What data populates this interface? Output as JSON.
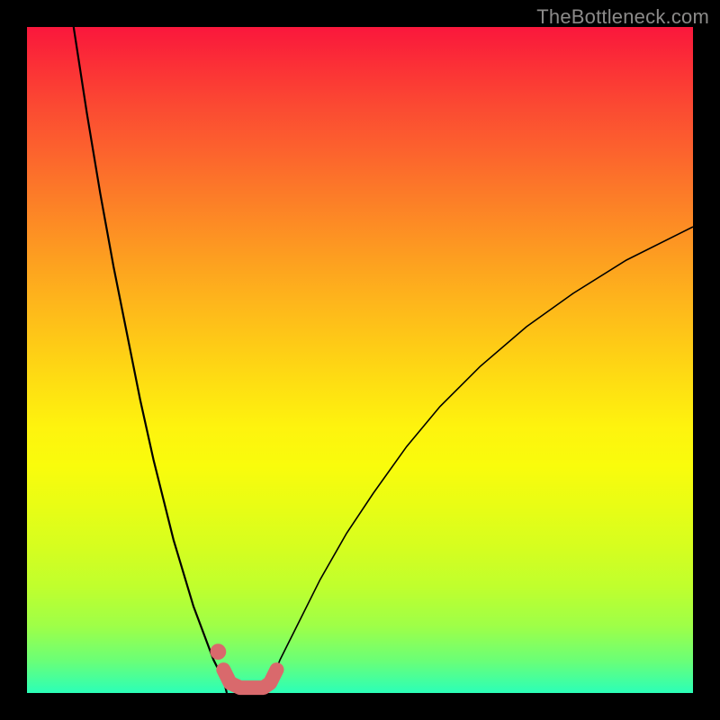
{
  "watermark": "TheBottleneck.com",
  "chart_data": {
    "type": "line",
    "title": "",
    "xlabel": "",
    "ylabel": "",
    "xlim": [
      0,
      100
    ],
    "ylim": [
      0,
      100
    ],
    "grid": false,
    "legend": false,
    "annotations": [],
    "series": [
      {
        "name": "left-curve",
        "color": "#000000",
        "x": [
          7,
          9,
          11,
          13,
          15,
          17,
          19,
          20.5,
          22,
          23.5,
          25,
          26.5,
          28,
          29.5,
          30
        ],
        "y": [
          100,
          87,
          75,
          64,
          54,
          44,
          35,
          29,
          23,
          18,
          13,
          9,
          5,
          2,
          0
        ]
      },
      {
        "name": "right-curve",
        "color": "#000000",
        "x": [
          36,
          38,
          41,
          44,
          48,
          52,
          57,
          62,
          68,
          75,
          82,
          90,
          100
        ],
        "y": [
          0,
          5,
          11,
          17,
          24,
          30,
          37,
          43,
          49,
          55,
          60,
          65,
          70
        ]
      },
      {
        "name": "bottom-band",
        "color": "#d9696c",
        "x": [
          29.5,
          30.5,
          32,
          34,
          35.5,
          36.5,
          37.5
        ],
        "y": [
          3.5,
          1.5,
          0.8,
          0.8,
          0.8,
          1.5,
          3.5
        ]
      }
    ],
    "markers": [
      {
        "name": "left-dot",
        "x": 28.7,
        "y": 6.2,
        "color": "#d9696c",
        "r": 1.2
      }
    ]
  }
}
